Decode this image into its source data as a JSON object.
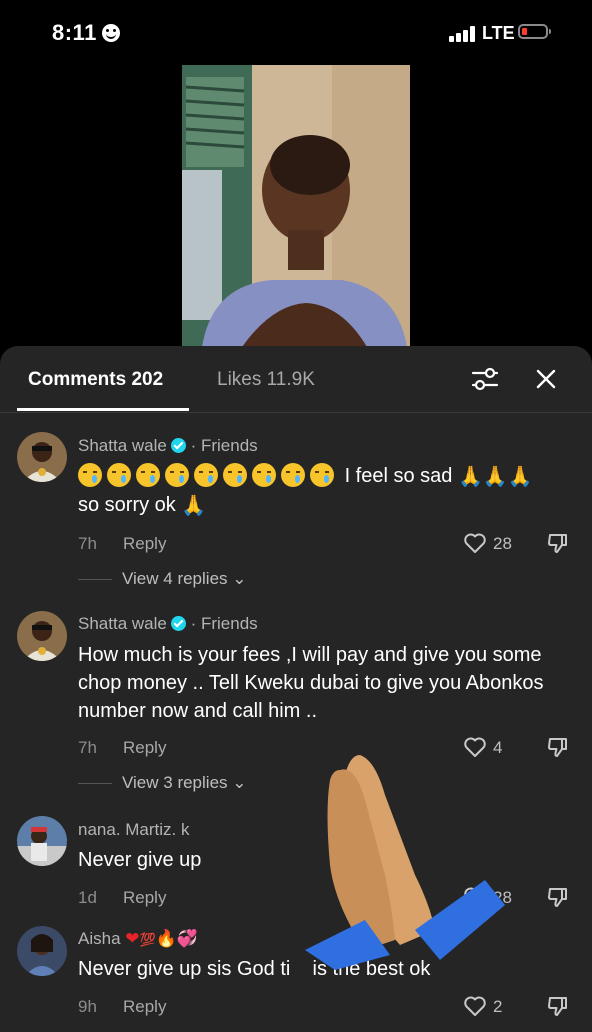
{
  "status_bar": {
    "time": "8:11",
    "network": "LTE"
  },
  "tabs": {
    "comments_label": "Comments 202",
    "likes_label": "Likes 11.9K"
  },
  "comments": [
    {
      "username": "Shatta wale",
      "verified": true,
      "relation": "· Friends",
      "text_part1": "I feel so sad",
      "text_part2": "so sorry ok",
      "time": "7h",
      "reply_label": "Reply",
      "likes": "28",
      "view_replies": "View 4 replies"
    },
    {
      "username": "Shatta wale",
      "verified": true,
      "relation": "· Friends",
      "text": "How much is your fees ,I will pay and give you some chop money .. Tell Kweku dubai to give you Abonkos number now and call him ..",
      "time": "7h",
      "reply_label": "Reply",
      "likes": "4",
      "view_replies": "View 3 replies"
    },
    {
      "username": "nana. Martiz. k",
      "text": "Never give up",
      "time": "1d",
      "reply_label": "Reply",
      "likes": "28"
    },
    {
      "username": "Aisha",
      "text": "Never give up sis God ti    is the best ok",
      "time": "9h",
      "reply_label": "Reply",
      "likes": "2"
    }
  ],
  "icons": {
    "filter": "sliders-icon",
    "close": "close-icon",
    "like": "heart-outline-icon",
    "dislike": "thumbs-down-icon",
    "sticker": "praying-hands-sticker"
  },
  "colors": {
    "sheet_bg": "#252525",
    "verified": "#20d5ec",
    "battery_low": "#ff3b30"
  }
}
